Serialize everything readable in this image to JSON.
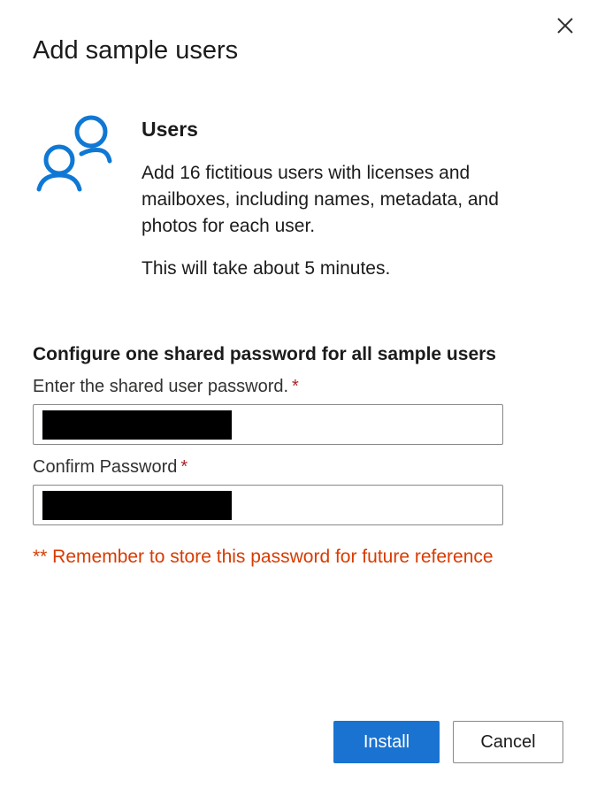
{
  "dialog": {
    "title": "Add sample users",
    "close_icon": "close-icon"
  },
  "info": {
    "icon": "users-icon",
    "heading": "Users",
    "description": "Add 16 fictitious users with licenses and mailboxes, including names, metadata, and photos for each user.",
    "time_note": "This will take about 5 minutes."
  },
  "password_section": {
    "heading": "Configure one shared password for all sample users",
    "password_label": "Enter the shared user password.",
    "confirm_label": "Confirm Password",
    "required_marker": "*",
    "warning": "** Remember to store this password for future reference"
  },
  "footer": {
    "install_label": "Install",
    "cancel_label": "Cancel"
  },
  "colors": {
    "accent": "#1a73d1",
    "icon_blue": "#0f78d4",
    "required": "#a4262c",
    "warning": "#d83b01"
  }
}
